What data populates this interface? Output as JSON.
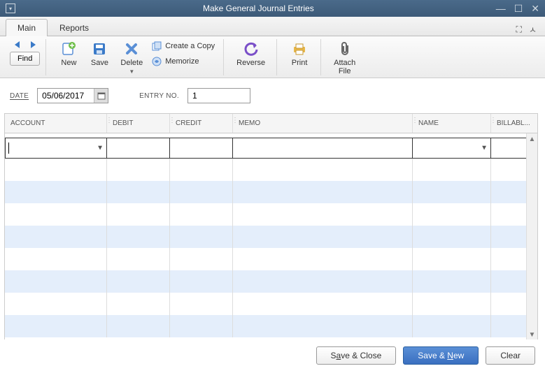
{
  "window": {
    "title": "Make General Journal Entries"
  },
  "tabs": {
    "main": "Main",
    "reports": "Reports"
  },
  "toolbar": {
    "find": "Find",
    "new": "New",
    "save": "Save",
    "delete": "Delete",
    "create_copy": "Create a Copy",
    "memorize": "Memorize",
    "reverse": "Reverse",
    "print": "Print",
    "attach_file": "Attach\nFile"
  },
  "form": {
    "date_label": "Date",
    "date_value": "05/06/2017",
    "entry_label": "Entry No.",
    "entry_value": "1"
  },
  "columns": {
    "account": "Account",
    "debit": "Debit",
    "credit": "Credit",
    "memo": "Memo",
    "name": "Name",
    "billable": "Billabl..."
  },
  "active_row": {
    "account": "",
    "debit": "",
    "credit": "",
    "memo": "",
    "name": "",
    "billable": ""
  },
  "footer": {
    "save_close": "Save & Close",
    "save_new": "Save & New",
    "clear": "Clear"
  }
}
